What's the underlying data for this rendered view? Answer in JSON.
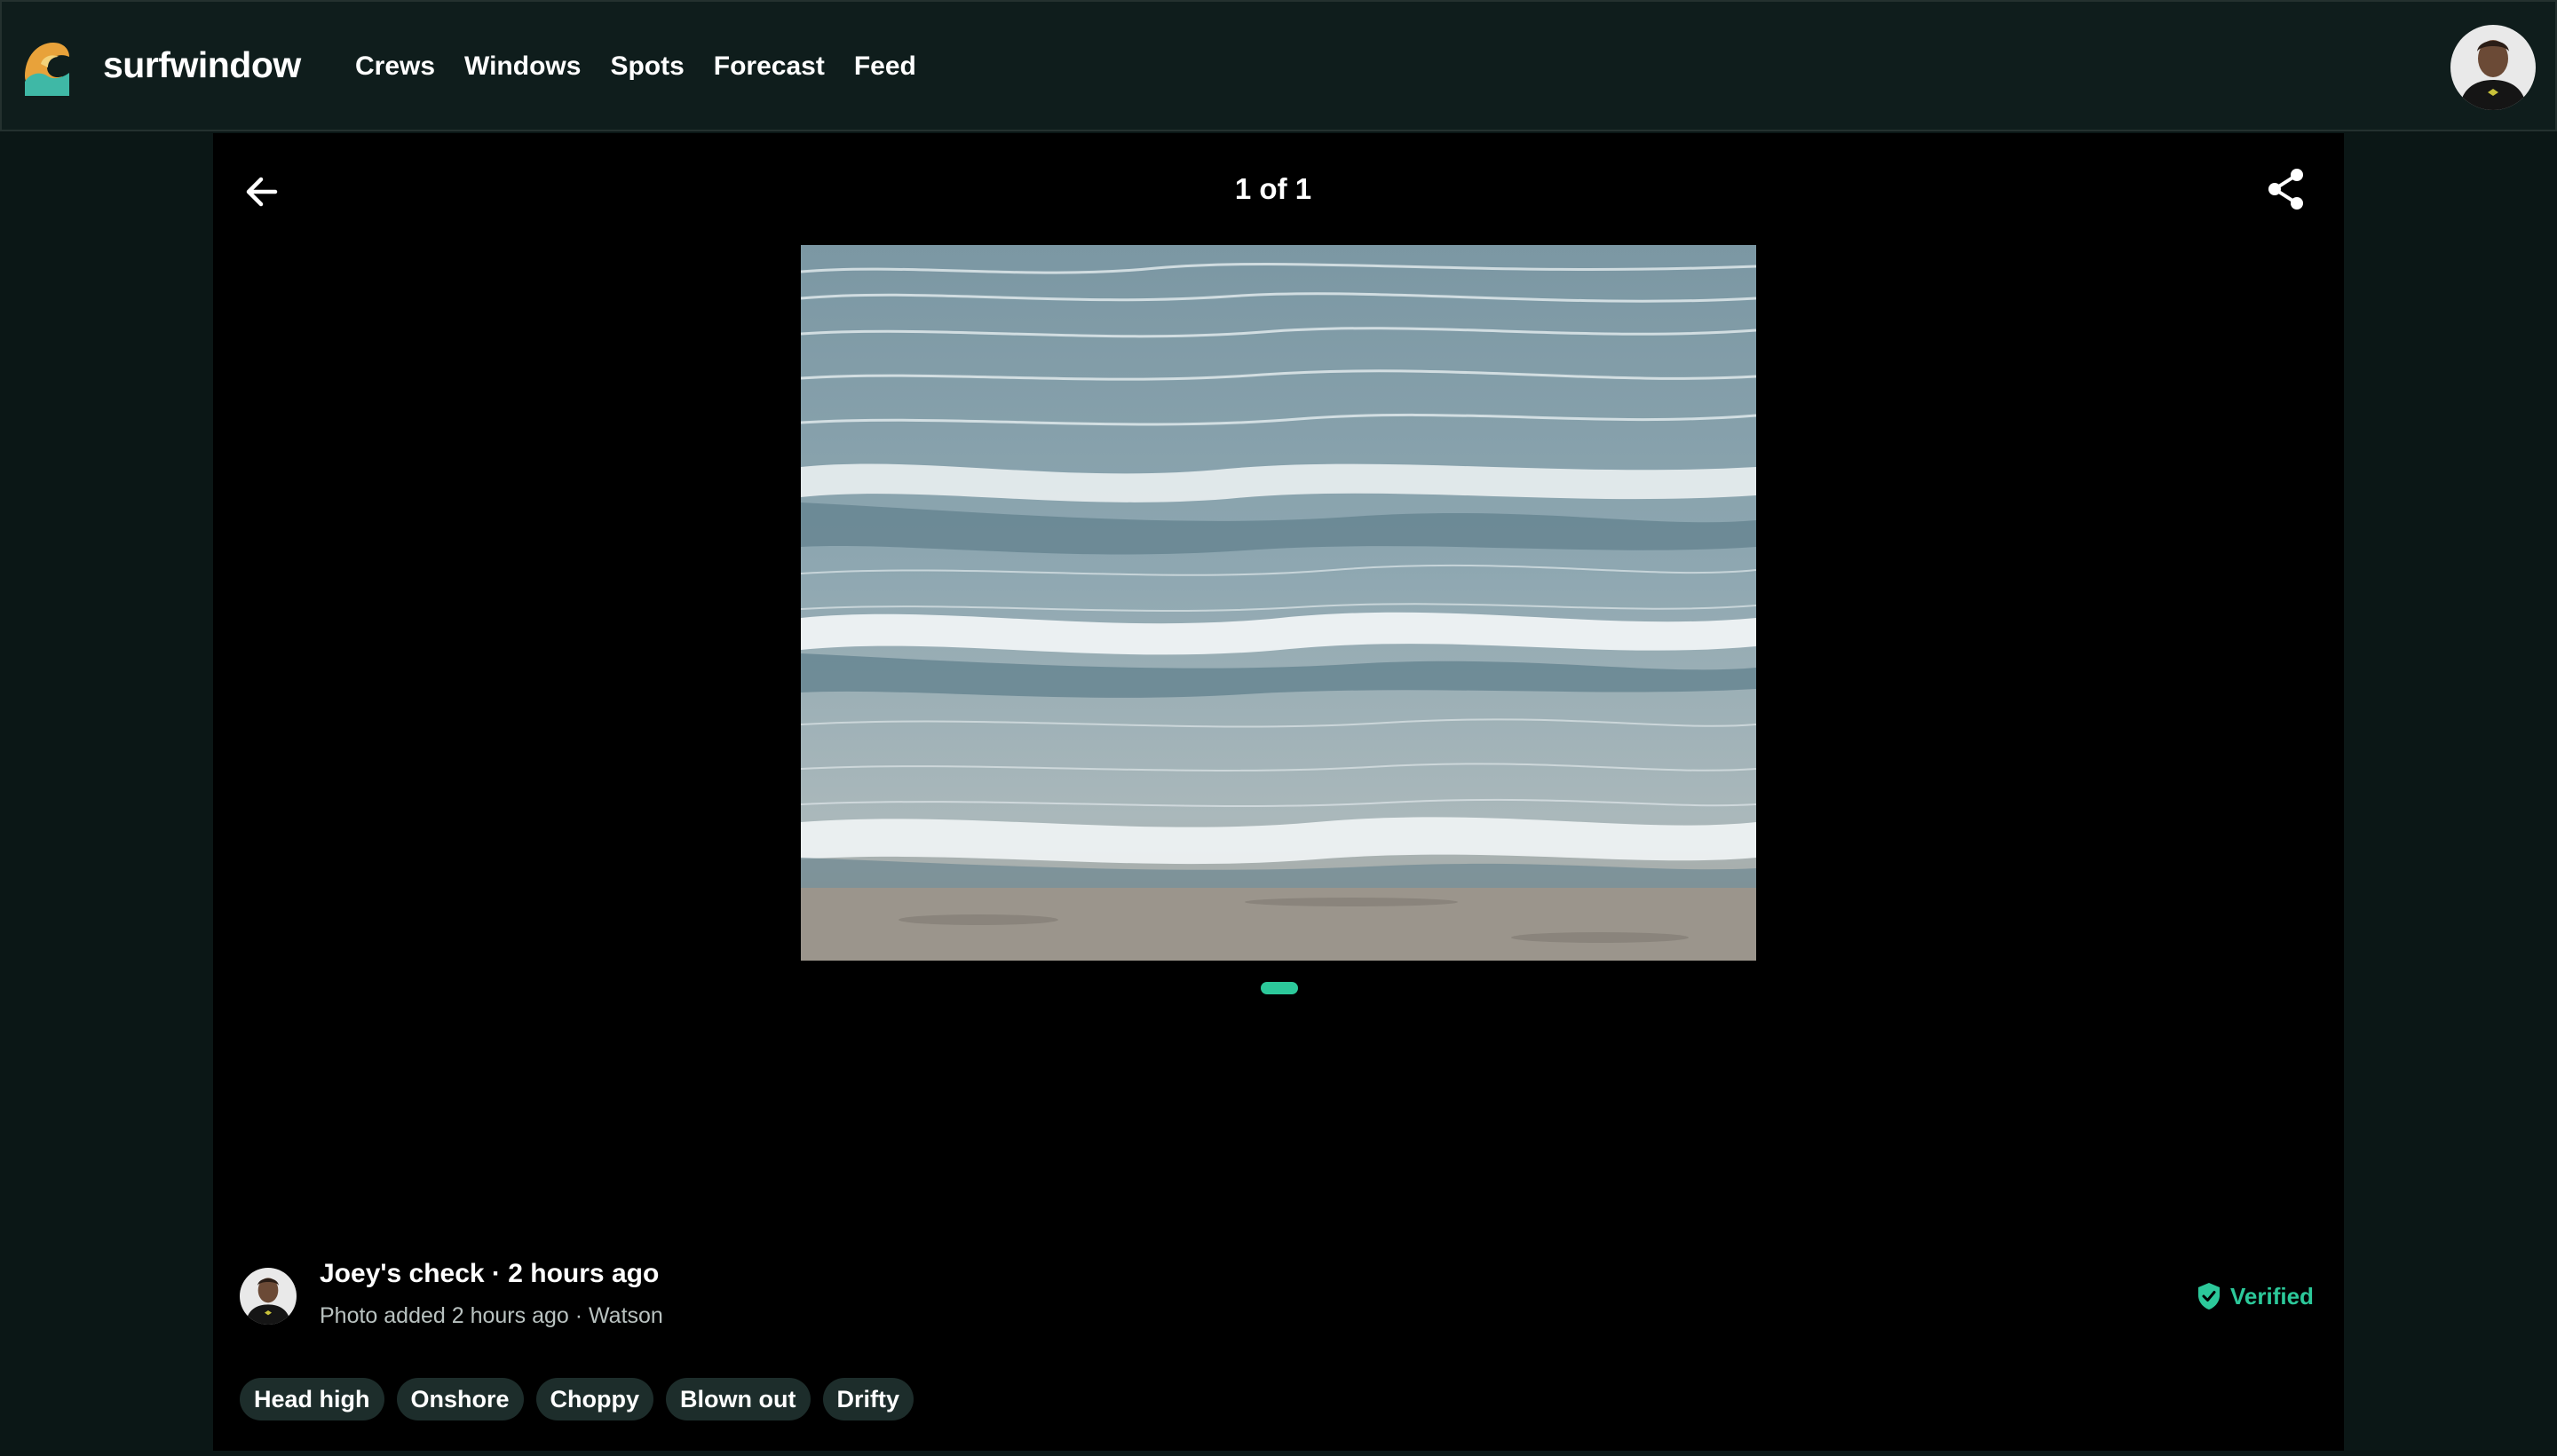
{
  "header": {
    "brand": "surfwindow",
    "nav": [
      "Crews",
      "Windows",
      "Spots",
      "Forecast",
      "Feed"
    ]
  },
  "viewer": {
    "counter": "1 of 1",
    "author_line": "Joey's check · 2 hours ago",
    "meta_line": "Photo added 2 hours ago · Watson",
    "verified_label": "Verified",
    "tags": [
      "Head high",
      "Onshore",
      "Choppy",
      "Blown out",
      "Drifty"
    ]
  },
  "colors": {
    "accent": "#2cc89a",
    "background": "#0b1716",
    "header": "#0f1d1c",
    "viewer": "#000000",
    "tag": "#1d2d2b"
  },
  "icons": [
    "wave-logo-icon",
    "back-arrow-icon",
    "share-icon",
    "verified-shield-icon"
  ]
}
